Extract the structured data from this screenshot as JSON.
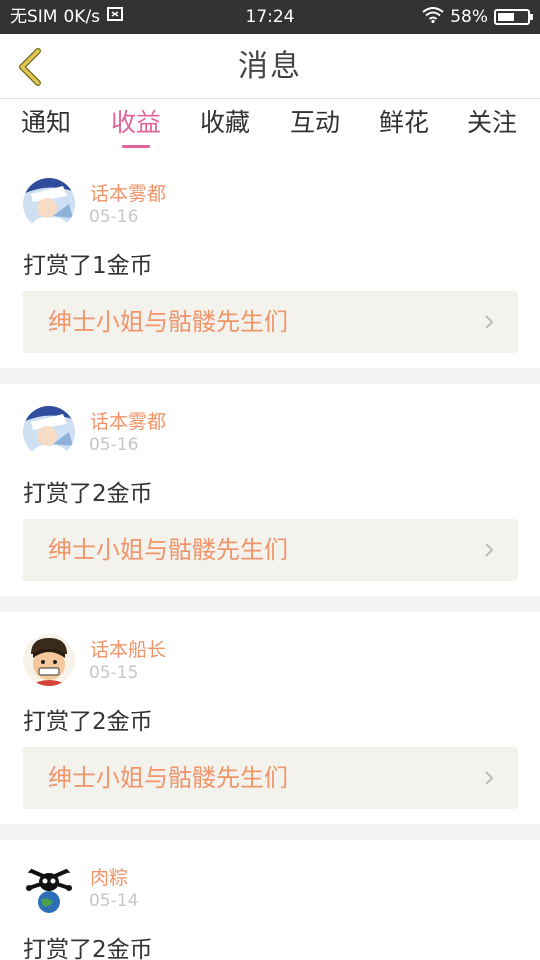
{
  "status_bar": {
    "carrier": "无SIM",
    "speed": "0K/s",
    "time": "17:24",
    "battery_text": "58%",
    "battery_level": 0.58,
    "text_color": "#ffffff",
    "bg_color": "#333333"
  },
  "header": {
    "title": "消息",
    "back_icon": "chevron-left-icon",
    "back_color": "#d9b84a"
  },
  "tabs": [
    {
      "label": "通知",
      "active": false
    },
    {
      "label": "收益",
      "active": true
    },
    {
      "label": "收藏",
      "active": false
    },
    {
      "label": "互动",
      "active": false
    },
    {
      "label": "鲜花",
      "active": false
    },
    {
      "label": "关注",
      "active": false
    }
  ],
  "accent_color": "#e0649a",
  "name_color": "#f0956a",
  "items": [
    {
      "user": "话本雾都",
      "date": "05-16",
      "message": "打赏了1金币",
      "work_title": "绅士小姐与骷髅先生们",
      "avatar_icon": "avatar-blue"
    },
    {
      "user": "话本雾都",
      "date": "05-16",
      "message": "打赏了2金币",
      "work_title": "绅士小姐与骷髅先生们",
      "avatar_icon": "avatar-blue"
    },
    {
      "user": "话本船长",
      "date": "05-15",
      "message": "打赏了2金币",
      "work_title": "绅士小姐与骷髅先生们",
      "avatar_icon": "avatar-straw-hat"
    },
    {
      "user": "肉粽",
      "date": "05-14",
      "message": "打赏了2金币",
      "work_title": "",
      "avatar_icon": "avatar-skull-globe"
    }
  ]
}
